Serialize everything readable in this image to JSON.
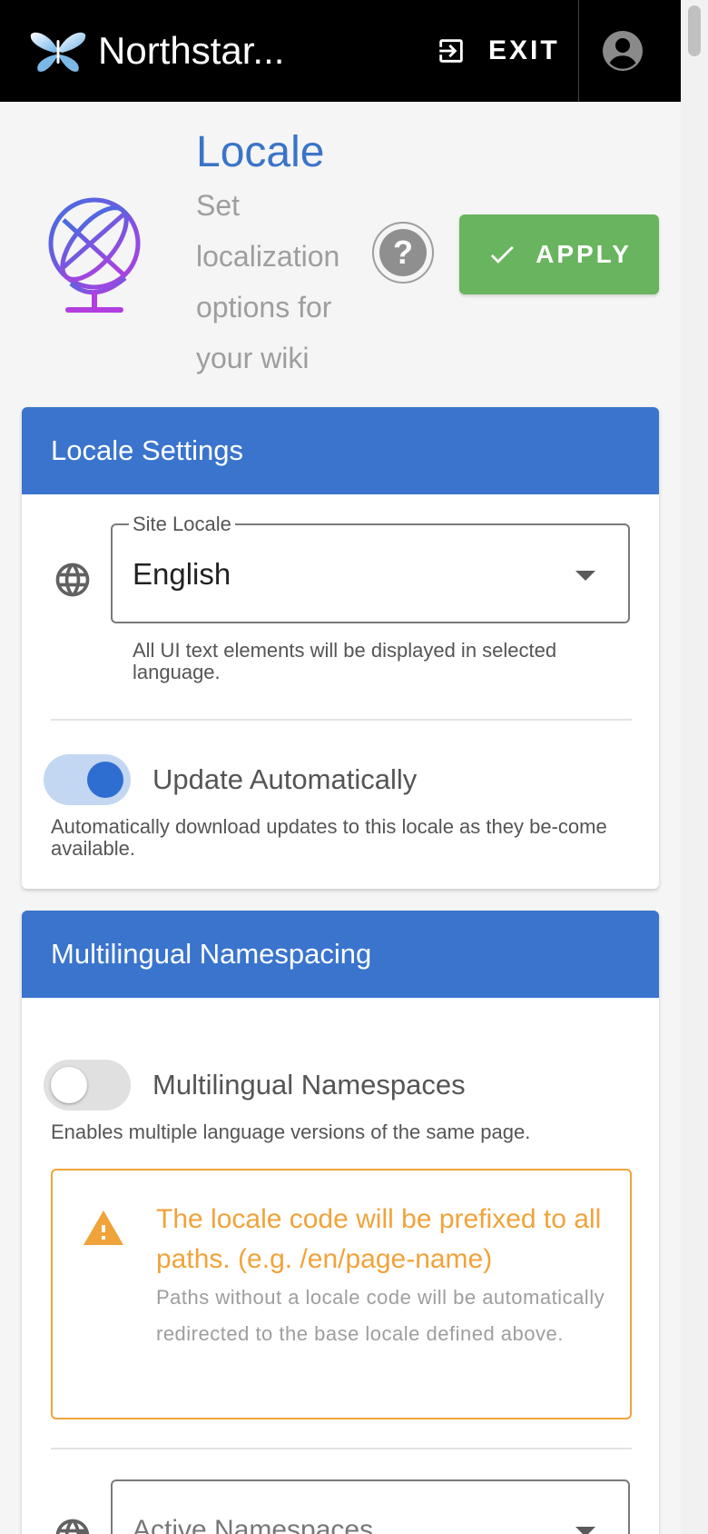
{
  "topbar": {
    "app_title": "Northstar...",
    "exit_label": "EXIT",
    "exit_icon": "exit-to-app-icon",
    "account_icon": "account-circle-icon"
  },
  "header": {
    "title": "Locale",
    "subtitle": "Set localization options for your wiki",
    "help_label": "?",
    "apply_label": "APPLY"
  },
  "locale_settings": {
    "heading": "Locale Settings",
    "site_locale": {
      "label": "Site Locale",
      "value": "English",
      "hint": "All UI text elements will be displayed in selected language."
    },
    "auto_update": {
      "label": "Update Automatically",
      "enabled": true,
      "hint": "Automatically download updates to this locale as they be-come available."
    }
  },
  "multilingual": {
    "heading": "Multilingual Namespacing",
    "namespaces_toggle": {
      "label": "Multilingual Namespaces",
      "enabled": false,
      "hint": "Enables multiple language versions of the same page."
    },
    "alert": {
      "title": "The locale code will be prefixed to all paths. (e.g. /en/page-name)",
      "body": "Paths without a locale code will be automatically redirected to the base locale defined above."
    },
    "active_namespaces": {
      "placeholder": "Active Namespaces"
    }
  },
  "colors": {
    "topbar": "#000000",
    "accent_blue": "#3a74cd",
    "apply_green": "#69b45e",
    "warning_orange": "#f0a33a"
  }
}
